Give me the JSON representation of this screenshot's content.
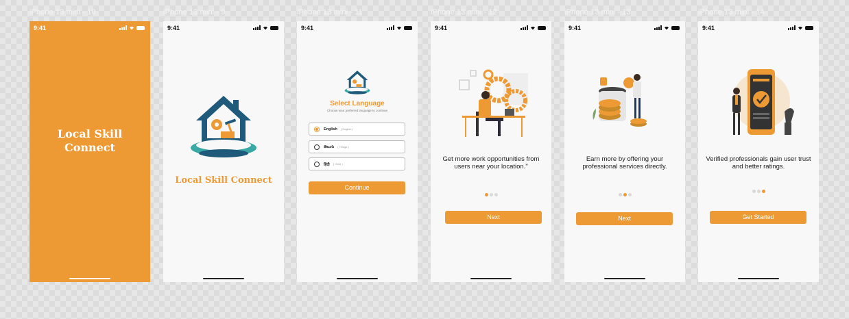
{
  "frames": [
    {
      "label": "iPhone 13 mini - 10",
      "time": "9:41",
      "title_line1": "Local Skill",
      "title_line2": "Connect"
    },
    {
      "label": "iPhone 13 mini - 9",
      "time": "9:41",
      "title": "Local Skill Connect"
    },
    {
      "label": "iPhone 13 mini - 11",
      "time": "9:41",
      "heading": "Select Language",
      "subheading": "Choose your preferred language to continue",
      "options": [
        {
          "name": "English",
          "sub": "( English )",
          "selected": true
        },
        {
          "name": "తెలుగు",
          "sub": "( Telugu )",
          "selected": false
        },
        {
          "name": "हिंदी",
          "sub": "( Hindi )",
          "selected": false
        }
      ],
      "button": "Continue"
    },
    {
      "label": "iPhone 13 mini - 12",
      "time": "9:41",
      "text": "Get more work opportunities from users near your location.\"",
      "active_dot": 1,
      "button": "Next"
    },
    {
      "label": "iPhone 13 mini - 13",
      "time": "9:41",
      "text": "Earn more by offering your professional services directly.",
      "active_dot": 2,
      "button": "Next"
    },
    {
      "label": "iPhone 13 mini - 14",
      "time": "9:41",
      "text": "Verified professionals gain user trust and better ratings.",
      "active_dot": 3,
      "button": "Get Started"
    }
  ],
  "colors": {
    "accent": "#ee9a34",
    "teal": "#3aa9a6",
    "navy": "#1f5a7a"
  },
  "icons": [
    "signal-icon",
    "wifi-icon",
    "battery-icon",
    "logo-house-tools-icon"
  ]
}
